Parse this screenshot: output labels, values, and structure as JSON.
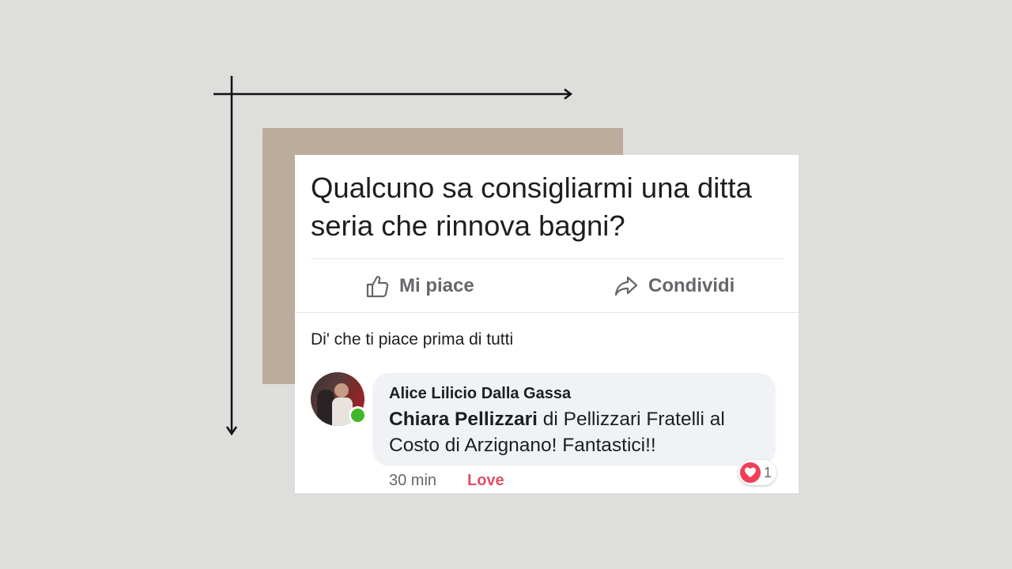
{
  "post": {
    "text": "Qualcuno sa consigliarmi una ditta seria che rinnova bagni?"
  },
  "actions": {
    "like_label": "Mi piace",
    "share_label": "Condividi"
  },
  "first_like_prompt": "Di' che ti piace prima di tutti",
  "comment": {
    "author": "Alice Lilicio Dalla Gassa",
    "mention": "Chiara Pellizzari",
    "text": " di Pellizzari Fratelli al Costo di Arzignano! Fantastici!!",
    "time": "30 min",
    "reaction_label": "Love",
    "reaction_count": "1"
  },
  "icons": {
    "like": "thumbs-up-icon",
    "share": "share-arrow-icon",
    "reaction": "heart-icon"
  },
  "colors": {
    "background": "#dededc",
    "beige_block": "#bdab9c",
    "love": "#e0506b",
    "heart": "#f33e58",
    "online": "#42b72a"
  }
}
